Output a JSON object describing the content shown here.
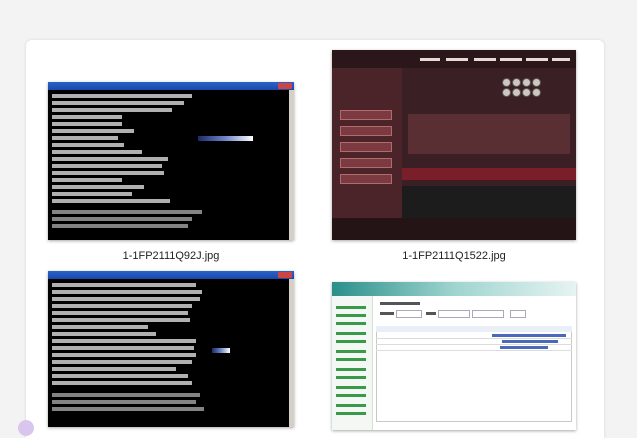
{
  "gallery": {
    "items": [
      {
        "filename": "1-1FP2111Q92J.jpg",
        "kind": "console-screenshot"
      },
      {
        "filename": "1-1FP2111Q1522.jpg",
        "kind": "game-ui-screenshot"
      },
      {
        "filename": "",
        "kind": "console-screenshot"
      },
      {
        "filename": "",
        "kind": "admin-ui-screenshot"
      }
    ]
  },
  "colors": {
    "page_bg": "#f3f3f3",
    "panel_bg": "#ffffff",
    "console_bg": "#000000",
    "console_title": "#2a62c9",
    "game_bg": "#3a2024",
    "admin_accent": "#2a8f8a"
  }
}
